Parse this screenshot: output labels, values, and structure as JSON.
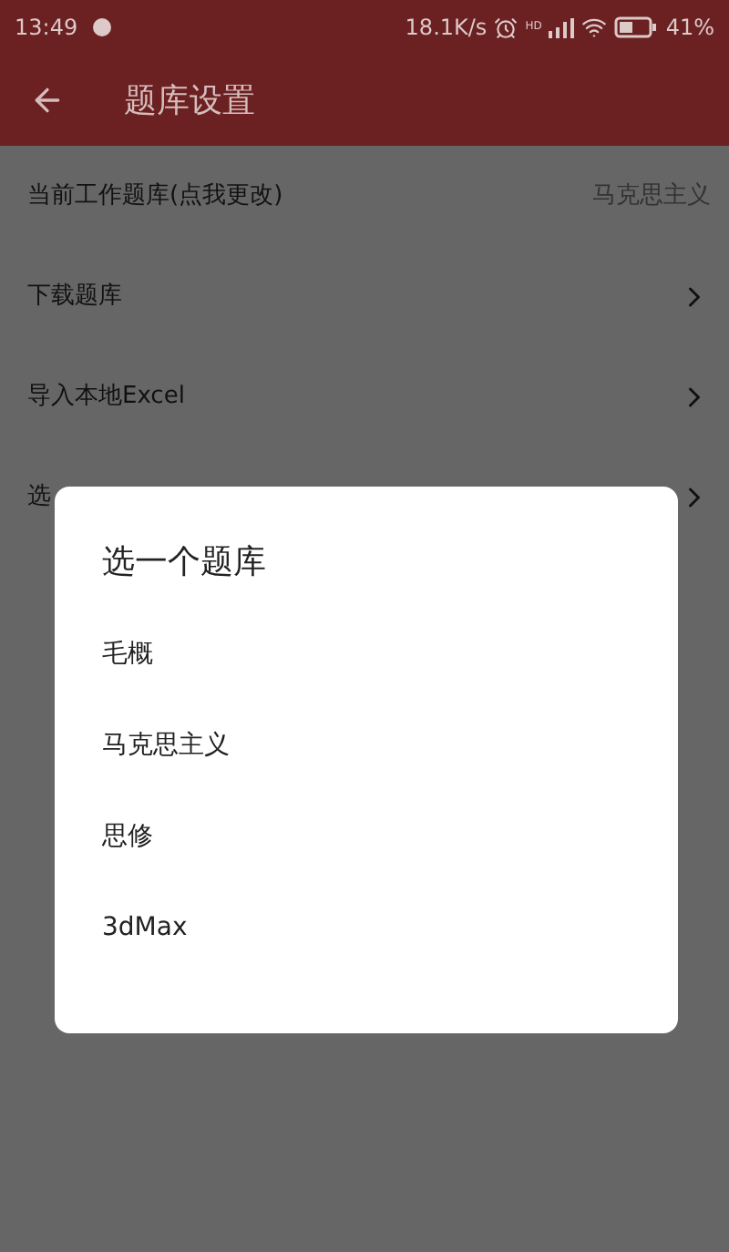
{
  "status_bar": {
    "time": "13:49",
    "speed": "18.1K/s",
    "network": "HD",
    "battery": "41%"
  },
  "app_bar": {
    "title": "题库设置"
  },
  "settings": [
    {
      "kind": "value",
      "label": "当前工作题库(点我更改)",
      "value": "马克思主义"
    },
    {
      "kind": "link",
      "label": "下载题库"
    },
    {
      "kind": "link",
      "label": "导入本地Excel"
    },
    {
      "kind": "link",
      "label": "选"
    }
  ],
  "dialog": {
    "title": "选一个题库",
    "options": [
      "毛概",
      "马克思主义",
      "思修",
      "3dMax"
    ]
  }
}
